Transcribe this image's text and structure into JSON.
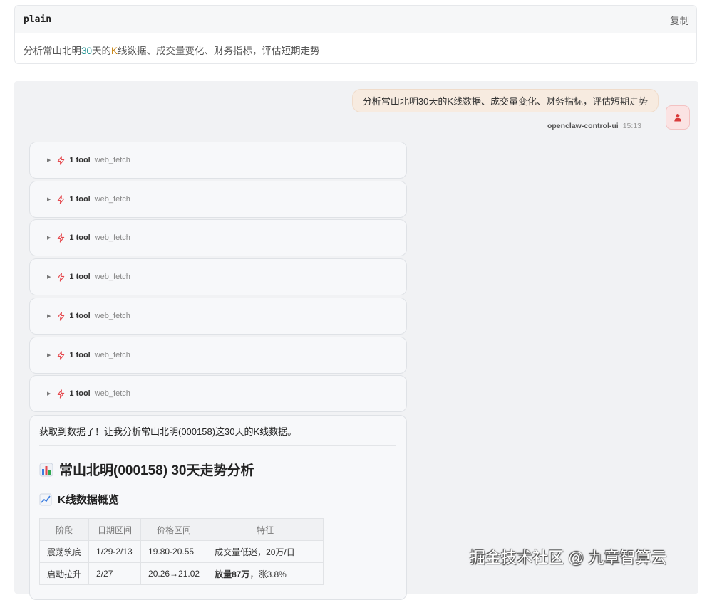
{
  "code_block": {
    "language": "plain",
    "copy_label": "复制",
    "content_parts": {
      "a": "分析常山北明",
      "num": "30",
      "b": "天的",
      "k": "K",
      "c": "线数据、成交量变化、财务指标，评估短期走势"
    }
  },
  "user_message": {
    "text": "分析常山北明30天的K线数据、成交量变化、财务指标，评估短期走势",
    "sender": "openclaw-control-ui",
    "time": "15:13"
  },
  "tool_calls": [
    {
      "count_label": "1 tool",
      "name": "web_fetch"
    },
    {
      "count_label": "1 tool",
      "name": "web_fetch"
    },
    {
      "count_label": "1 tool",
      "name": "web_fetch"
    },
    {
      "count_label": "1 tool",
      "name": "web_fetch"
    },
    {
      "count_label": "1 tool",
      "name": "web_fetch"
    },
    {
      "count_label": "1 tool",
      "name": "web_fetch"
    },
    {
      "count_label": "1 tool",
      "name": "web_fetch"
    }
  ],
  "assistant_reply": {
    "intro": "获取到数据了！让我分析常山北明(000158)这30天的K线数据。",
    "heading": "常山北明(000158) 30天走势分析",
    "heading_icon": "bar-chart-icon",
    "subheading": "K线数据概览",
    "subheading_icon": "trend-up-chart-icon",
    "table": {
      "headers": [
        "阶段",
        "日期区间",
        "价格区间",
        "特征"
      ],
      "rows": [
        {
          "stage": "震荡筑底",
          "dates": "1/29-2/13",
          "prices": "19.80-20.55",
          "feature_bold": "",
          "feature_rest": "成交量低迷，20万/日"
        },
        {
          "stage": "启动拉升",
          "dates": "2/27",
          "prices": "20.26→21.02",
          "feature_bold": "放量87万",
          "feature_rest": "，涨3.8%"
        }
      ]
    }
  },
  "watermark": "掘金技术社区 @ 九章智算云",
  "colors": {
    "user_bubble": "#f7ebe0",
    "avatar_bg": "#fbe3e3",
    "accent_red": "#e5484d",
    "chat_bg": "#f1f2f4"
  }
}
